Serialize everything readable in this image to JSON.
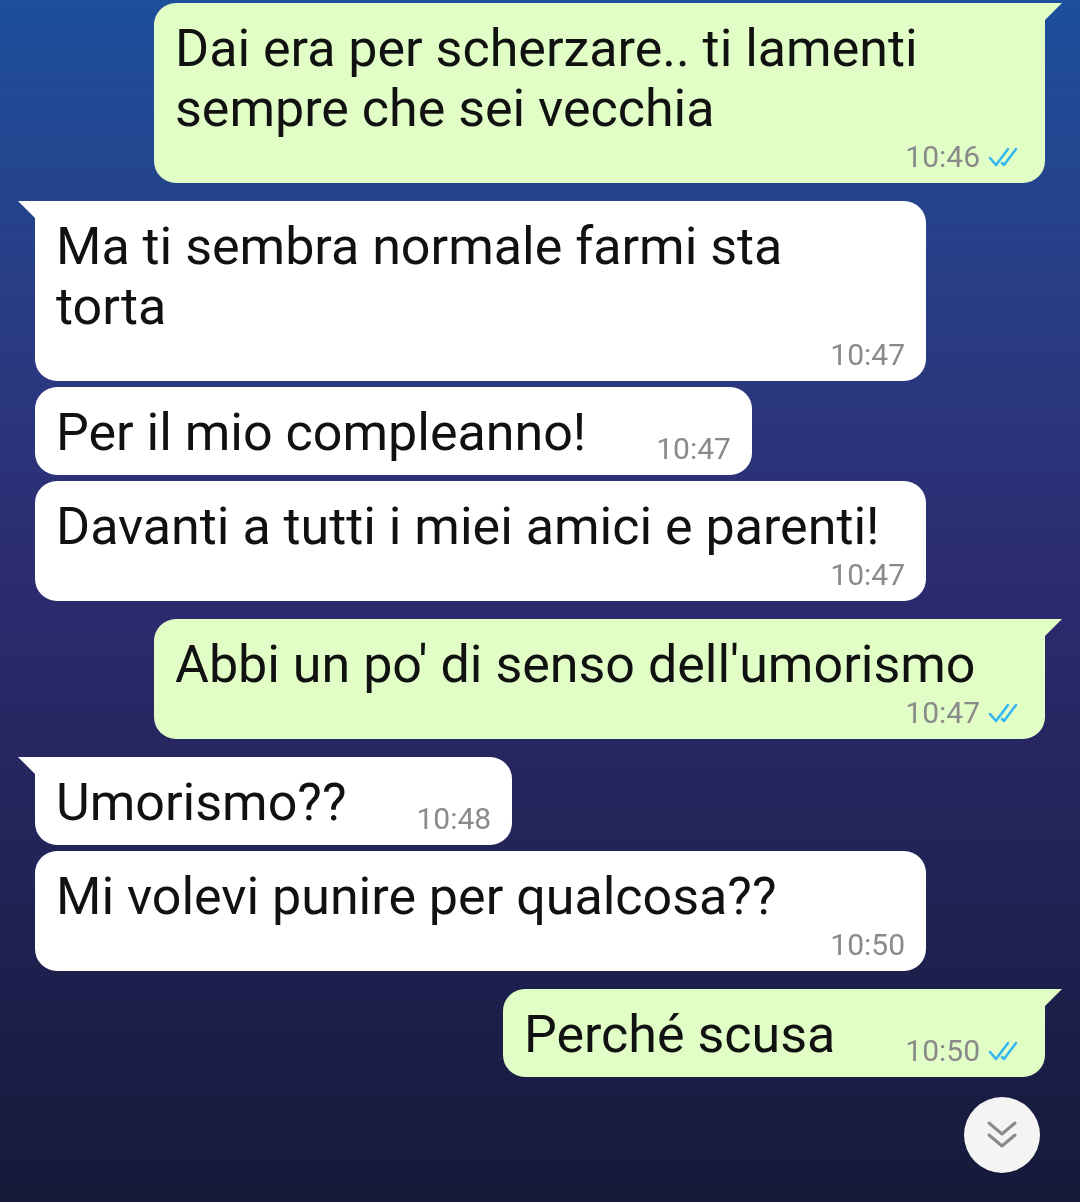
{
  "messages": [
    {
      "kind": "outgoing",
      "text": "Dai era per scherzare.. ti lamenti sempre che sei vecchia",
      "time": "10:46",
      "read": true,
      "first_in_group": true
    },
    {
      "kind": "incoming",
      "text": "Ma ti sembra normale farmi sta torta",
      "time": "10:47",
      "first_in_group": true
    },
    {
      "kind": "incoming",
      "text": "Per il mio compleanno!",
      "time": "10:47",
      "first_in_group": false
    },
    {
      "kind": "incoming",
      "text": "Davanti a tutti i miei amici e parenti!",
      "time": "10:47",
      "first_in_group": false
    },
    {
      "kind": "outgoing",
      "text": "Abbi un po' di senso dell'umorismo",
      "time": "10:47",
      "read": true,
      "first_in_group": true
    },
    {
      "kind": "incoming",
      "text": "Umorismo??",
      "time": "10:48",
      "first_in_group": true
    },
    {
      "kind": "incoming",
      "text": "Mi volevi punire per qualcosa??",
      "time": "10:50",
      "first_in_group": false
    },
    {
      "kind": "outgoing",
      "text": "Perché scusa",
      "time": "10:50",
      "read": true,
      "first_in_group": true
    }
  ]
}
